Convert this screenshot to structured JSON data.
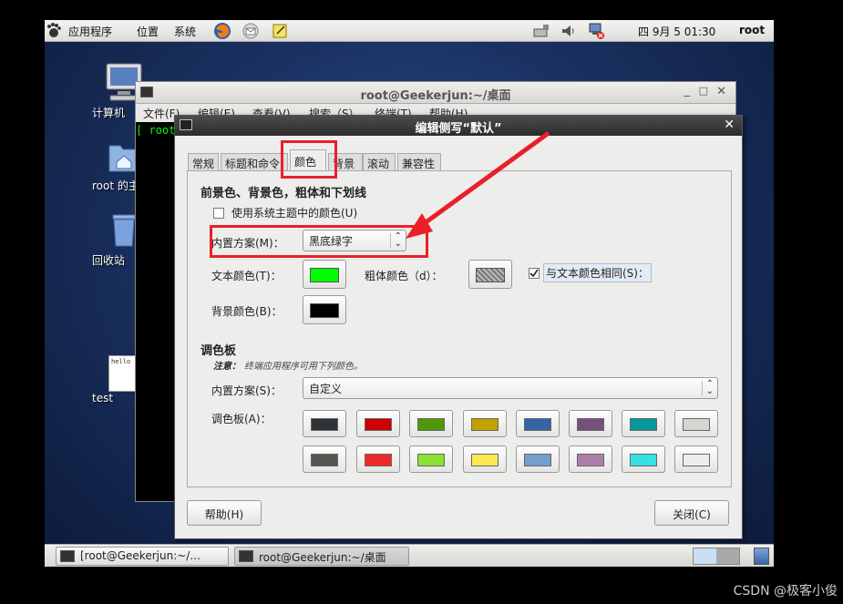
{
  "top_panel": {
    "apps_label": "应用程序",
    "places_label": "位置",
    "system_label": "系统",
    "datetime": "四  9月   5 01:30",
    "user": "root"
  },
  "desktop": {
    "icons": [
      {
        "label": "计算机"
      },
      {
        "label": "root 的主文件夹"
      },
      {
        "label": "回收站"
      },
      {
        "label": "test",
        "thumb_text": "hello"
      }
    ]
  },
  "terminal": {
    "title": "root@Geekerjun:~/桌面",
    "menu": [
      "文件(F)",
      "编辑(E)",
      "查看(V)",
      "搜索（S）",
      "终端(T)",
      "帮助(H)"
    ],
    "prompt": "[ root"
  },
  "dialog": {
    "title": "编辑侧写“默认”",
    "tabs": [
      "常规",
      "标题和命令",
      "颜色",
      "背景",
      "滚动",
      "兼容性"
    ],
    "active_tab": "颜色",
    "fg_section_title": "前景色、背景色，粗体和下划线",
    "use_system_theme_label": "使用系统主题中的颜色(U)",
    "builtin_scheme_label": "内置方案(M)：",
    "builtin_scheme_value": "黑底绿字",
    "text_color_label": "文本颜色(T)：",
    "bold_color_label": "粗体颜色（d）：",
    "same_as_text_label": "与文本颜色相同(S)：",
    "bg_color_label": "背景颜色(B)：",
    "palette_section_title": "调色板",
    "note_label": "注意：",
    "note_text": "终端应用程序可用下列颜色。",
    "palette_scheme_label": "内置方案(S)：",
    "palette_scheme_value": "自定义",
    "palette_label": "调色板(A)：",
    "help_button": "帮助(H)",
    "close_button": "关闭(C)",
    "colors": {
      "text": "#00ff00",
      "background": "#000000",
      "palette_row1": [
        "#2e3436",
        "#cc0000",
        "#4e9a06",
        "#c4a000",
        "#3465a4",
        "#75507b",
        "#06989a",
        "#d3d7cf"
      ],
      "palette_row2": [
        "#555753",
        "#ef2929",
        "#8ae234",
        "#fce94f",
        "#729fcf",
        "#ad7fa8",
        "#34e2e2",
        "#eeeeec"
      ]
    }
  },
  "taskbar": {
    "items": [
      "[root@Geekerjun:~/...",
      "root@Geekerjun:~/桌面"
    ]
  },
  "watermark": "CSDN @极客小俊"
}
